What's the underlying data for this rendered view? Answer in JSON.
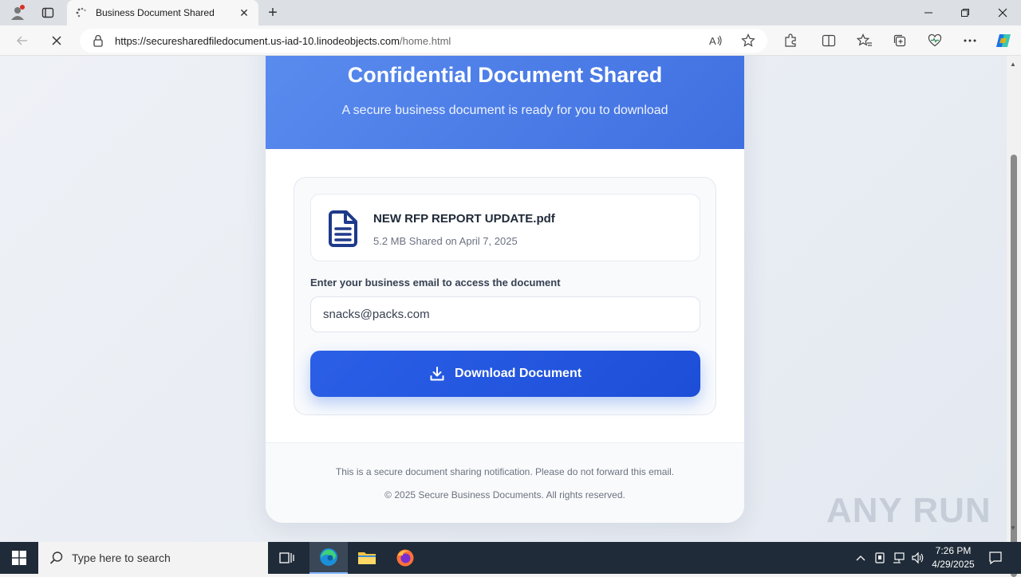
{
  "browser": {
    "tab_title": "Business Document Shared",
    "url_host": "https://securesharedfiledocument.us-iad-10.linodeobjects.com",
    "url_path": "/home.html",
    "tab_close": "✕",
    "new_tab": "+",
    "icons": [
      "profile-icon",
      "workspaces-icon",
      "loading-icon",
      "back-icon",
      "stop-icon",
      "lock-icon",
      "read-aloud-icon",
      "favorite-icon",
      "extensions-icon",
      "split-screen-icon",
      "favorites-icon",
      "collections-icon",
      "performance-icon",
      "more-icon",
      "copilot-icon"
    ]
  },
  "page": {
    "title": "Confidential Document Shared",
    "subtitle": "A secure business document is ready for you to download",
    "file_name": "NEW RFP REPORT UPDATE.pdf",
    "file_meta": "5.2 MB Shared on April 7, 2025",
    "email_label": "Enter your business email to access the document",
    "email_value": "snacks@packs.com",
    "button_label": "Download Document",
    "footer_notice": "This is a secure document sharing notification. Please do not forward this email.",
    "footer_copyright": "© 2025 Secure Business Documents. All rights reserved.",
    "accent_color": "#1d4ed8",
    "hero_color": "#4f7fe8"
  },
  "watermark": "ANY RUN",
  "taskbar": {
    "search_placeholder": "Type here to search",
    "time": "7:26 PM",
    "date": "4/29/2025"
  }
}
